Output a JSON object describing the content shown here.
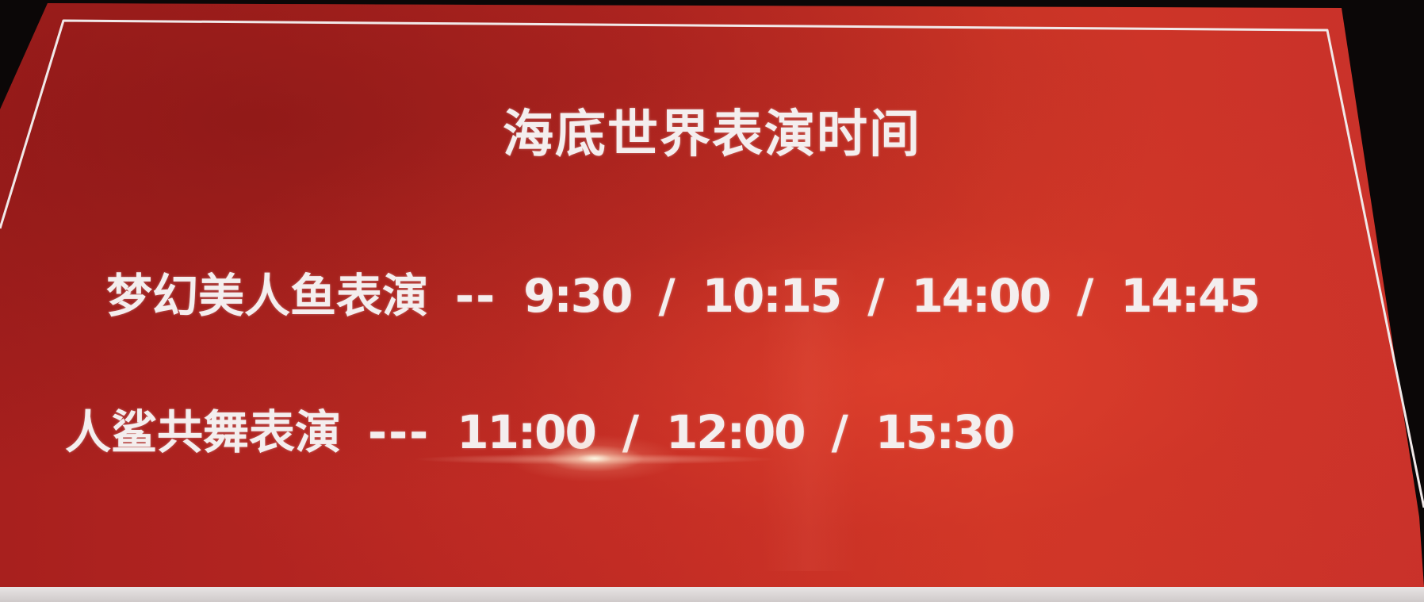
{
  "sign": {
    "title": "海底世界表演时间",
    "shows": [
      {
        "name": "梦幻美人鱼表演",
        "dash": "--",
        "times": [
          "9:30",
          "10:15",
          "14:00",
          "14:45"
        ]
      },
      {
        "name": "人鲨共舞表演",
        "dash": "---",
        "times": [
          "11:00",
          "12:00",
          "15:30"
        ]
      }
    ],
    "separator": "/"
  },
  "colors": {
    "board_red": "#c42d25",
    "text_white": "#f4eeee",
    "frame_white": "#f1e9e9"
  }
}
